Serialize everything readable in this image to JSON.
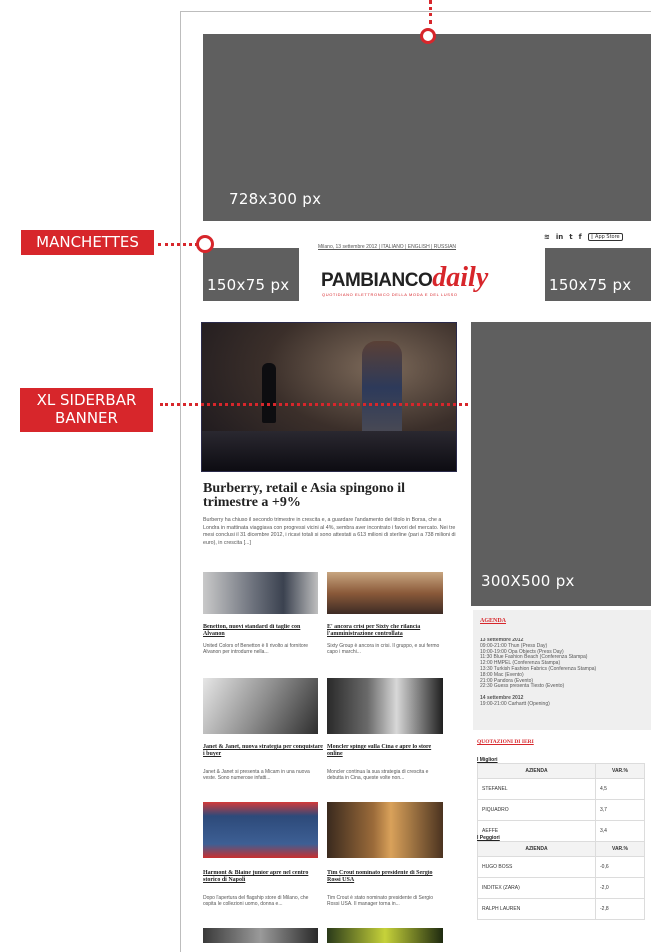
{
  "leaderboard": {
    "size": "728x300 px"
  },
  "manchette_left": {
    "size": "150x75 px"
  },
  "manchette_right": {
    "size": "150x75 px"
  },
  "sidebar_banner": {
    "size": "300X500 px"
  },
  "callouts": {
    "manchettes": "MANCHETTES",
    "xl_sidebar": "XL SIDERBAR BANNER"
  },
  "header": {
    "dateline": "Milano, 13 settembre 2012 | ITALIANO | ENGLISH | RUSSIAN",
    "logo_main": "PAMBIANCO",
    "logo_script": "daily",
    "tagline": "QUOTIDIANO ELETTRONICO DELLA MODA E DEL LUSSO",
    "social": [
      "rss",
      "in",
      "t",
      "f"
    ],
    "app_store": "App Store"
  },
  "lead_article": {
    "title": "Burberry, retail e Asia spingono il trimestre a +9%",
    "body": "Burberry ha chiuso il secondo trimestre in crescita e, a guardare l'andamento del titolo in Borsa, che a Londra in mattinata viaggiava con progressi vicini al 4%, sembra aver incontrato i favori del mercato. Nei tre mesi conclusi il 31 dicembre 2012, i ricavi totali si sono attestati a 613 milioni di sterline (pari a 738 milioni di euro), in crescita [...]"
  },
  "articles": [
    {
      "title": "Benetton, nuovi standard di taglie con Alvanon",
      "excerpt": "United Colors of Benetton è lì rivolto ai fornitore Alvanon per introdurre nella..."
    },
    {
      "title": "E' ancora crisi per Sixty che rilancia l'amministrazione controllata",
      "excerpt": "Sixty Group è ancora in crisi. Il gruppo, e sui fermo capo i marchi..."
    },
    {
      "title": "Janet & Janet, nuova strategia per conquistare i buyer",
      "excerpt": "Janet & Janet si presenta a Micam in una nuova veste. Sono numerose infatti..."
    },
    {
      "title": "Moncler spinge sulla Cina e apre lo store online",
      "excerpt": "Moncler continua la sua strategia di crescita e debutta in Cina, queste volte non..."
    },
    {
      "title": "Harmont & Blaine junior apre nel centro storico di Napoli",
      "excerpt": "Dopo l'apertura del flagship store di Milano, che ospita le collezioni uomo, donna e..."
    },
    {
      "title": "Tim Crout nominato presidente di Sergio Rossi USA",
      "excerpt": "Tim Crout è stato nominato presidente di Sergio Rossi USA. Il manager torna in..."
    }
  ],
  "agenda": {
    "heading": "AGENDA",
    "lines": [
      "13 settembre 2012",
      "09:00-21:00 Thun (Press Day)",
      "10:00-19:00 Opa Objects (Press Day)",
      "11:30 Blue Fashion Beach (Conferenza Stampa)",
      "12:00 HMPEL (Conferenza Stampa)",
      "13:30 Turkish Fashion Fabrics (Conferenza Stampa)",
      "18:00 Mac (Evento)",
      "21:00 Pandora (Evento)",
      "22:30 Guess presenta Tiesto (Evento)",
      "",
      "14 settembre 2012",
      "19:00-21:00 Carhartt (Opening)"
    ]
  },
  "quotes": {
    "heading": "QUOTAZIONI DI IERI",
    "best_label": "I Migliori",
    "worst_label": "I Peggiori",
    "col_company": "AZIENDA",
    "col_var": "VAR.%",
    "best": [
      [
        "STEFANEL",
        "4,5"
      ],
      [
        "PIQUADRO",
        "3,7"
      ],
      [
        "AEFFE",
        "3,4"
      ]
    ],
    "worst": [
      [
        "HUGO BOSS",
        "-0,6"
      ],
      [
        "INDITEX (ZARA)",
        "-2,0"
      ],
      [
        "RALPH LAUREN",
        "-2,8"
      ]
    ]
  }
}
